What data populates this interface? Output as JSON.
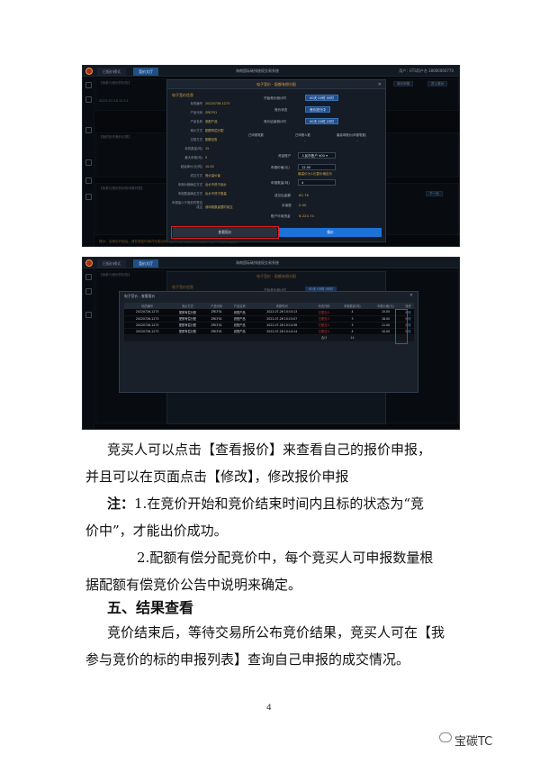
{
  "screen1": {
    "tabs": [
      "已报价模式",
      "竞价大厅"
    ],
    "app_title": "海南国际碳排放权交易系统",
    "user_info": "用户：ETS用户名 18066060770",
    "bg_left_items": [
      "【我参与竞价的标的】",
      "【我的历史竞价记录】",
      "【我参与竞价的标的申报列表】"
    ],
    "bg_right_buttons": [
      "竞价申报",
      "进入竞价"
    ],
    "bg_date": "2023-07-26 12:11",
    "bg_next_btn": "下一页",
    "status_text": "提示：当竞价开始后，请在规定时间内完成出价，否则将自动放弃竞价资格，报价不得低于起始价",
    "modal": {
      "title": "电子竞价 - 配额有偿分配",
      "close": "✕",
      "section": "电子竞价信息",
      "fields": [
        {
          "k": "标的编号",
          "v": "20220726-1273"
        },
        {
          "k": "产品代码",
          "v": "ZRCF01"
        },
        {
          "k": "产品名称",
          "v": "张配产品"
        },
        {
          "k": "竞价方式",
          "v": "配额有偿分配"
        },
        {
          "k": "交易方式",
          "v": "配额出售"
        },
        {
          "k": "标的数量(吨)",
          "v": "15"
        },
        {
          "k": "最大申报(吨)",
          "v": "5"
        },
        {
          "k": "起始单价(元/吨)",
          "v": "10.00"
        },
        {
          "k": "成交方式",
          "v": "竞价高价者"
        },
        {
          "k": "申报价格确定方式",
          "v": "出价不低于起价"
        },
        {
          "k": "申报数量确定方式",
          "v": "出价不低于数量"
        },
        {
          "k": "申报量小于竞拍时是否成交",
          "v": "我申报数量暂时成交"
        }
      ],
      "start_time_label": "开始竞价倒计时",
      "start_time_value": "00天 00时 00时",
      "status_label": "竞价状态",
      "status_value": "竞价进行中",
      "end_time_label": "竞价结束倒计时",
      "end_time_value": "00天 00时 23时",
      "col_headers": [
        "已申报笔数",
        "已申报人数",
        "最高申报价(申报笔数)"
      ],
      "col_values": [
        "–",
        "–",
        "–"
      ],
      "fund_label": "资金账户",
      "fund_value": "人民币账户 ¥00 ▾",
      "price_label": "申报价格(元)",
      "price_value": "12.00",
      "price_hint": "最高价为1元整价格定价",
      "qty_label": "申报数量(吨)",
      "qty_value": "4",
      "amount_label": "成交后金额",
      "amount_value": "62.76",
      "fee_label": "手续费",
      "fee_value": "0.00",
      "balance_label": "账户可用资金",
      "balance_value": "6,224.74",
      "view_quote_btn": "查看报价",
      "confirm_btn": "报价"
    }
  },
  "screen2": {
    "bg_title": "电子竞价 - 配额有偿分配",
    "bg_section": "电子竞价信息",
    "bg_time_label": "开始竞价倒计时",
    "bg_time_value": "00天 00时 00时",
    "modal_title": "电子竞价 - 查看报价",
    "close": "✕",
    "headers": [
      "标的编号",
      "竞价方式",
      "产品代码",
      "产品名称",
      "申报时间",
      "状态代码",
      "申报数量(吨)",
      "申报价格(元)",
      "操作"
    ],
    "rows": [
      [
        "20220726-1273",
        "配额有偿分配",
        "ZRCF01",
        "张配产品",
        "2022-07-26 10:15:13",
        "已提交人",
        "4",
        "15.00",
        "修改"
      ],
      [
        "20220726-1273",
        "配额有偿分配",
        "ZRCF01",
        "张配产品",
        "2022-07-26 10:15:07",
        "已提交人",
        "3",
        "18.00",
        "修改"
      ],
      [
        "20220726-1273",
        "配额有偿分配",
        "ZRCF01",
        "张配产品",
        "2022-07-26 10:14:36",
        "已提交人",
        "3",
        "11.00",
        "修改"
      ],
      [
        "20220726-1273",
        "配额有偿分配",
        "ZRCF01",
        "张配产品",
        "2022-07-26 10:14:14",
        "已提交人",
        "4",
        "10.00",
        "修改"
      ]
    ],
    "sum_label": "合计",
    "sum_value": "14"
  },
  "text": {
    "p1_line1": "竞买人可以点击【查看报价】来查看自己的报价申报，",
    "p1_line2": "并且可以在页面点击【修改】，修改报价申报",
    "note_label": "注：",
    "note1_line1": "1.在竞价开始和竞价结束时间内且标的状态为“竞",
    "note1_line2": "价中”，才能出价成功。",
    "note2_line1": "2.配额有偿分配竞价中，每个竞买人可申报数量根",
    "note2_line2": "据配额有偿竞价公告中说明来确定。",
    "section5": "五、结果查看",
    "p5_line1": "竞价结束后，等待交易所公布竞价结果，竞买人可在【我",
    "p5_line2": "参与竞价的标的申报列表】查询自己申报的成交情况。",
    "page_number": "4",
    "watermark": "宝碳TC"
  }
}
